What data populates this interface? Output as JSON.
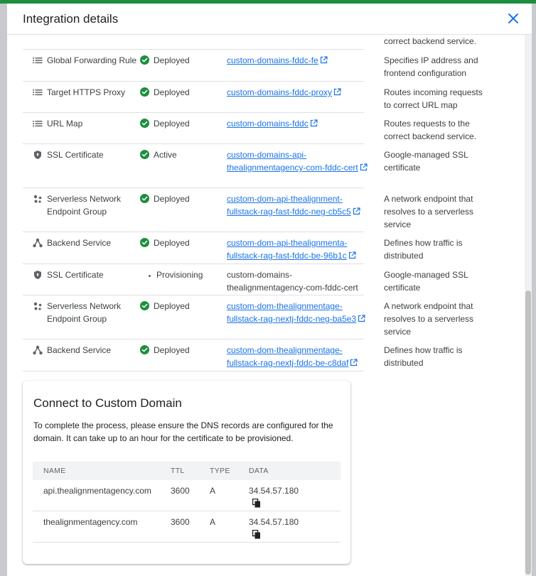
{
  "dialog": {
    "title": "Integration details"
  },
  "top_partial_desc": "correct backend service.",
  "resources": [
    {
      "type": "Global Forwarding Rule",
      "icon": "list-icon",
      "status": "Deployed",
      "name": "custom-domains-fddc-fe",
      "link": true,
      "desc": "Specifies IP address and frontend configuration",
      "h": 45
    },
    {
      "type": "Target HTTPS Proxy",
      "icon": "list-icon",
      "status": "Deployed",
      "name": "custom-domains-fddc-proxy",
      "link": true,
      "desc": "Routes incoming requests to correct URL map",
      "h": 44
    },
    {
      "type": "URL Map",
      "icon": "list-icon",
      "status": "Deployed",
      "name": "custom-domains-fddc",
      "link": true,
      "desc": "Routes requests to the correct backend service.",
      "h": 44
    },
    {
      "type": "SSL Certificate",
      "icon": "shield-icon",
      "status": "Active",
      "name": "custom-domains-api-thealignmentagency-com-fddc-cert",
      "link": true,
      "desc": "Google-managed SSL certificate",
      "h": 62
    },
    {
      "type": "Serverless Network Endpoint Group",
      "icon": "network-icon",
      "status": "Deployed",
      "name": "custom-dom-api-thealignment-fullstack-rag-fast-fddc-neg-cb5c5",
      "link": true,
      "desc": "A network endpoint that resolves to a serverless service",
      "h": 62
    },
    {
      "type": "Backend Service",
      "icon": "hierarchy-icon",
      "status": "Deployed",
      "name": "custom-dom-api-thealignmenta-fullstack-rag-fast-fddc-be-96b1c",
      "link": true,
      "desc": "Defines how traffic is distributed",
      "h": 45
    },
    {
      "type": "SSL Certificate",
      "icon": "shield-icon",
      "status": "Provisioning",
      "name": "custom-domains-thealignmentagency-com-fddc-cert",
      "link": false,
      "desc": "Google-managed SSL certificate",
      "h": 44
    },
    {
      "type": "Serverless Network Endpoint Group",
      "icon": "network-icon",
      "status": "Deployed",
      "name": "custom-dom-thealignmentage-fullstack-rag-nextj-fddc-neg-ba5e3",
      "link": true,
      "desc": "A network endpoint that resolves to a serverless service",
      "h": 62
    },
    {
      "type": "Backend Service",
      "icon": "hierarchy-icon",
      "status": "Deployed",
      "name": "custom-dom-thealignmentage-fullstack-rag-nextj-fddc-be-c8daf",
      "link": true,
      "desc": "Defines how traffic is distributed",
      "h": 45
    }
  ],
  "connect": {
    "title": "Connect to Custom Domain",
    "description": "To complete the process, please ensure the DNS records are configured for the domain. It can take up to an hour for the certificate to be provisioned.",
    "columns": [
      "NAME",
      "TTL",
      "TYPE",
      "DATA"
    ],
    "records": [
      {
        "name": "api.thealignmentagency.com",
        "ttl": "3600",
        "type": "A",
        "data": "34.54.57.180"
      },
      {
        "name": "thealignmentagency.com",
        "ttl": "3600",
        "type": "A",
        "data": "34.54.57.180"
      }
    ]
  },
  "colors": {
    "accent": "#1a73e8",
    "success": "#1e8e3e"
  }
}
